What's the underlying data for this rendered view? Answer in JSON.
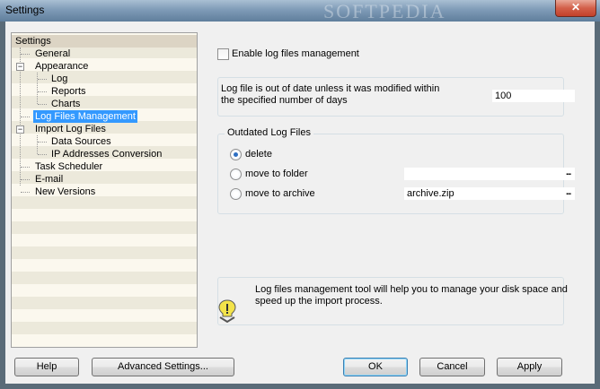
{
  "window": {
    "title": "Settings",
    "watermark": "SOFTPEDIA",
    "close_label": "✕"
  },
  "tree": {
    "header": "Settings",
    "items": [
      {
        "label": "General"
      },
      {
        "label": "Appearance"
      },
      {
        "label": "Log"
      },
      {
        "label": "Reports"
      },
      {
        "label": "Charts"
      },
      {
        "label": "Log Files Management"
      },
      {
        "label": "Import Log Files"
      },
      {
        "label": "Data Sources"
      },
      {
        "label": "IP Addresses Conversion"
      },
      {
        "label": "Task Scheduler"
      },
      {
        "label": "E-mail"
      },
      {
        "label": "New Versions"
      }
    ],
    "selected": "Log Files Management"
  },
  "main": {
    "enable_label": "Enable log files management",
    "enable_checked": false,
    "outdated_text_line1": "Log file is out of date unless it was modified within",
    "outdated_text_line2": "the specified number of days",
    "days_value": "100",
    "group_title": "Outdated Log Files",
    "options": {
      "delete": "delete",
      "move_to_folder": "move to folder",
      "move_to_archive": "move to archive"
    },
    "selected_option": "delete",
    "folder_value": "",
    "archive_value": "archive.zip",
    "browse_label": "...",
    "info_line1": "Log files management tool will help you to manage your disk space and",
    "info_line2": "speed up the import process."
  },
  "buttons": {
    "help": "Help",
    "advanced": "Advanced Settings...",
    "ok": "OK",
    "cancel": "Cancel",
    "apply": "Apply"
  }
}
